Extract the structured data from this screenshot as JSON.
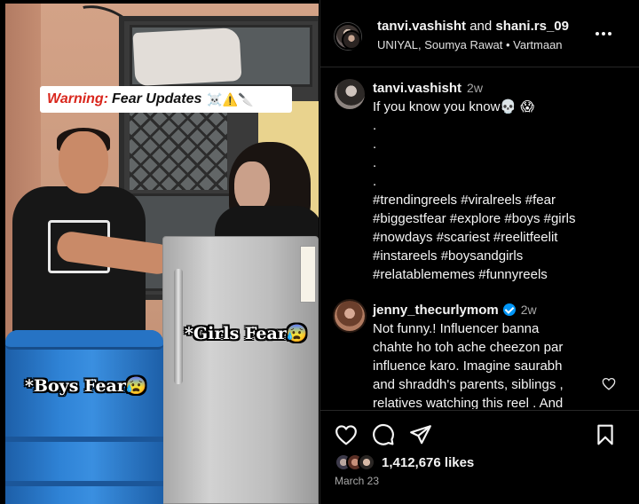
{
  "post": {
    "header": {
      "user1": "tanvi.vashisht",
      "and_text": " and ",
      "user2": "shani.rs_09",
      "subtitle": "UNIYAL, Soumya Rawat • Vartmaan"
    },
    "video": {
      "banner_warning": "Warning:",
      "banner_rest": "Fear Updates",
      "banner_emoji": "☠️⚠️🔪",
      "caption_girls": "*Girls Fear😰",
      "caption_boys": "*Boys Fear😰"
    },
    "comments": [
      {
        "username": "tanvi.vashisht",
        "time": "2w",
        "verified": false,
        "lines": [
          "If you know you know💀 😱",
          ".",
          ".",
          ".",
          ".",
          "#trendingreels #viralreels #fear",
          "#biggestfear #explore #boys #girls",
          "#nowdays #scariest #reelitfeelit",
          "#instareels #boysandgirls",
          "#relatablememes #funnyreels"
        ]
      },
      {
        "username": "jenny_thecurlymom",
        "time": "2w",
        "verified": true,
        "lines": [
          "Not funny.! Influencer banna",
          "chahte ho toh ache cheezon par",
          "influence karo. Imagine saurabh",
          "and shraddh's parents, siblings ,",
          "relatives watching this reel . And"
        ]
      }
    ],
    "likes": "1,412,676 likes",
    "date": "March 23",
    "icons": {
      "more": "more-options-icon",
      "like": "heart-icon",
      "comment": "comment-icon",
      "share": "send-icon",
      "save": "bookmark-icon",
      "comment_like": "heart-icon"
    },
    "colors": {
      "background": "#000000",
      "text": "#f5f5f5",
      "secondary_text": "#a8a8a8",
      "verified": "#0095f6",
      "divider": "#262626",
      "warning_red": "#d9261c"
    }
  }
}
